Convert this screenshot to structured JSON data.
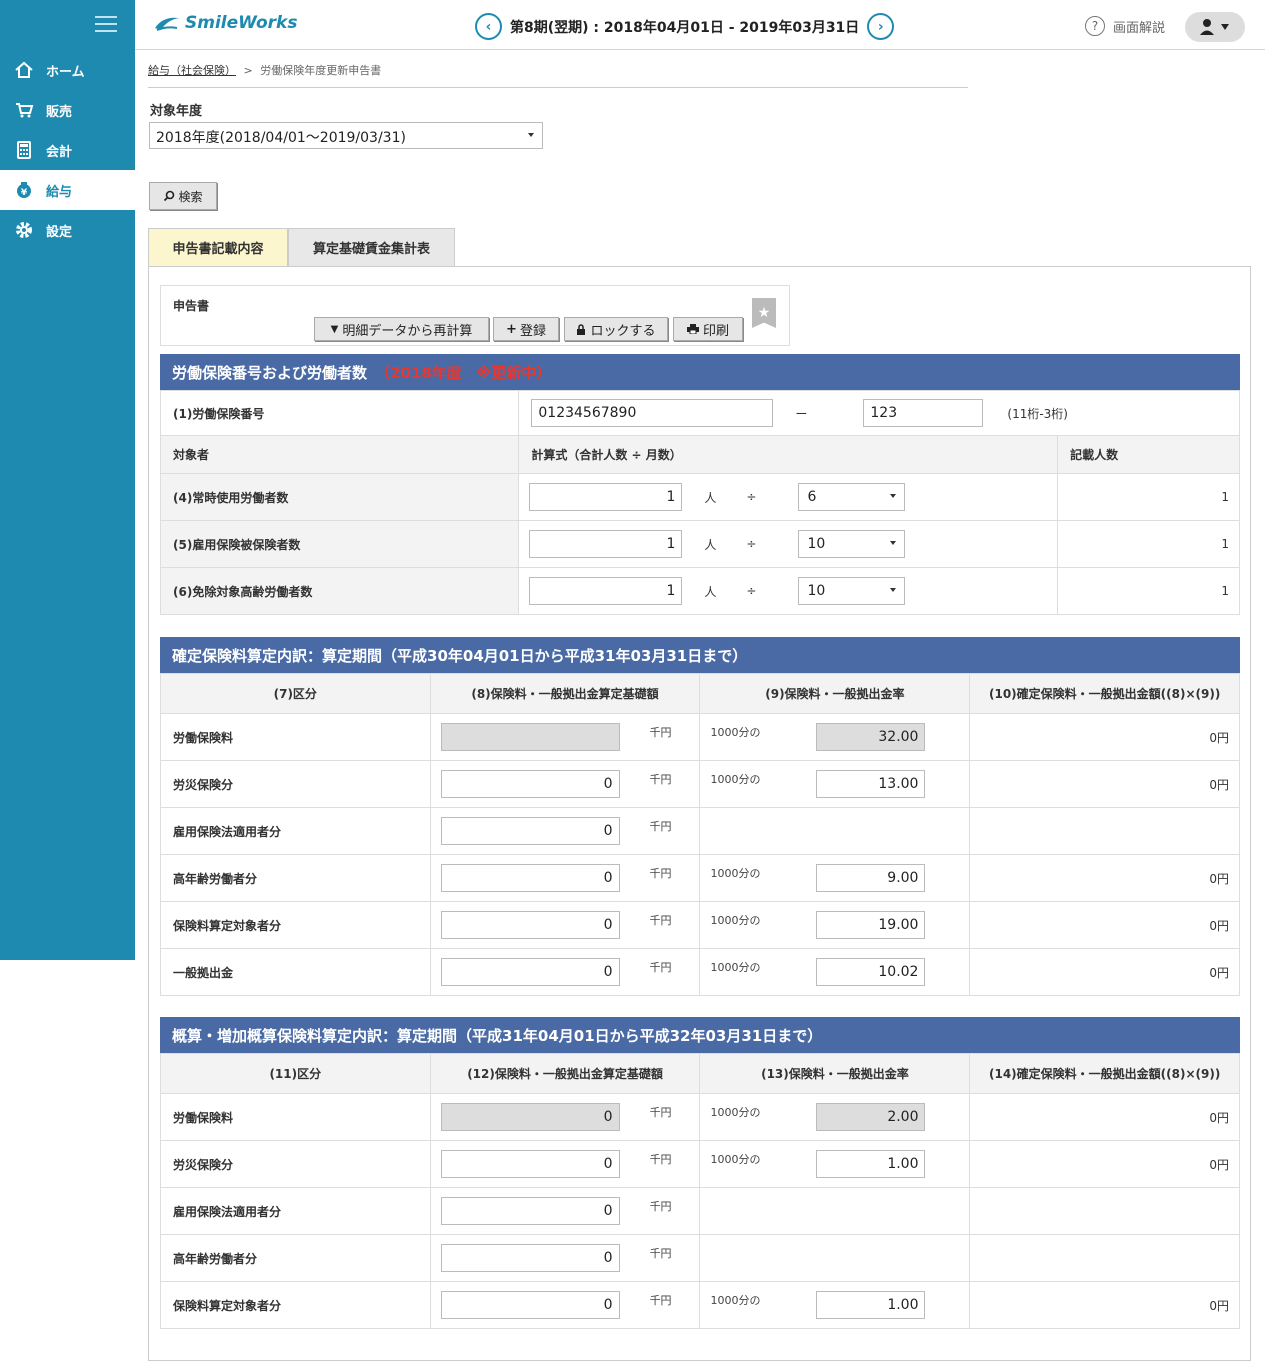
{
  "header": {
    "logo_text": "SmileWorks",
    "period": "第8期(翌期) : 2018年04月01日 - 2019年03月31日",
    "help": "画面解説"
  },
  "nav": [
    {
      "label": "ホーム",
      "icon": "home-icon"
    },
    {
      "label": "販売",
      "icon": "cart-icon"
    },
    {
      "label": "会計",
      "icon": "calculator-icon"
    },
    {
      "label": "給与",
      "icon": "moneybag-icon"
    },
    {
      "label": "設定",
      "icon": "gear-icon"
    }
  ],
  "breadcrumb": {
    "parent": "給与（社会保険）",
    "sep": ">",
    "current": "労働保険年度更新申告書"
  },
  "year_label": "対象年度",
  "year_value": "2018年度(2018/04/01～2019/03/31)",
  "search_btn": "検索",
  "tabs": [
    "申告書記載内容",
    "算定基礎賃金集計表"
  ],
  "toolbar": {
    "label": "申告書",
    "recalc": "明細データから再計算",
    "register": "登録",
    "lock": "ロックする",
    "print": "印刷"
  },
  "sec1": {
    "title": "労働保険番号および労働者数",
    "status": "（2018年度　※更新中）",
    "insurance_label": "(1)労働保険番号",
    "insurance_no1": "01234567890",
    "dash": "ー",
    "insurance_no2": "123",
    "digits_hint": "(11桁-3桁)",
    "col_target": "対象者",
    "col_formula": "計算式（合計人数 ÷ 月数）",
    "col_count": "記載人数",
    "rows": [
      {
        "label": "(4)常時使用労働者数",
        "value": "1",
        "unit": "人",
        "div": "÷",
        "months": "6",
        "count": "1"
      },
      {
        "label": "(5)雇用保険被保険者数",
        "value": "1",
        "unit": "人",
        "div": "÷",
        "months": "10",
        "count": "1"
      },
      {
        "label": "(6)免除対象高齢労働者数",
        "value": "1",
        "unit": "人",
        "div": "÷",
        "months": "10",
        "count": "1"
      }
    ]
  },
  "sec2": {
    "title": "確定保険料算定内訳：算定期間（平成30年04月01日から平成31年03月31日まで）",
    "cols": [
      "(7)区分",
      "(8)保険料・一般拠出金算定基礎額",
      "(9)保険料・一般拠出金率",
      "(10)確定保険料・一般拠出金額((8)×(9))"
    ],
    "unit": "千円",
    "rate_prefix": "1000分の",
    "rows": [
      {
        "label": "労働保険料",
        "base": "",
        "rate": "32.00",
        "amount": "0円"
      },
      {
        "label": "労災保険分",
        "base": "0",
        "rate": "13.00",
        "amount": "0円"
      },
      {
        "label": "雇用保険法適用者分",
        "base": "0"
      },
      {
        "label": "高年齢労働者分",
        "base": "0",
        "rate": "9.00",
        "amount": "0円"
      },
      {
        "label": "保険料算定対象者分",
        "base": "0",
        "rate": "19.00",
        "amount": "0円"
      },
      {
        "label": "一般拠出金",
        "base": "0",
        "rate": "10.02",
        "amount": "0円"
      }
    ]
  },
  "sec3": {
    "title": "概算・増加概算保険料算定内訳：算定期間（平成31年04月01日から平成32年03月31日まで）",
    "cols": [
      "(11)区分",
      "(12)保険料・一般拠出金算定基礎額",
      "(13)保険料・一般拠出金率",
      "(14)確定保険料・一般拠出金額((8)×(9))"
    ],
    "unit": "千円",
    "rate_prefix": "1000分の",
    "rows": [
      {
        "label": "労働保険料",
        "base": "0",
        "rate": "2.00",
        "amount": "0円"
      },
      {
        "label": "労災保険分",
        "base": "0",
        "rate": "1.00",
        "amount": "0円"
      },
      {
        "label": "雇用保険法適用者分",
        "base": "0"
      },
      {
        "label": "高年齢労働者分",
        "base": "0"
      },
      {
        "label": "保険料算定対象者分",
        "base": "0",
        "rate": "1.00",
        "amount": "0円"
      }
    ]
  },
  "colors": {
    "sidebar": "#1e8aaf",
    "section_header": "#4a6aa5",
    "status_red": "#e8372f",
    "active_tab": "#fcf6cf"
  }
}
